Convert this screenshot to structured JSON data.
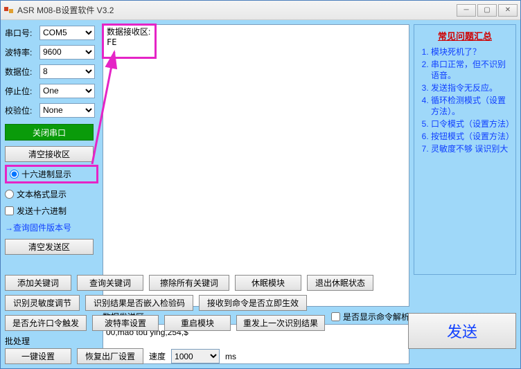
{
  "window": {
    "title": "ASR M08-B设置软件 V3.2"
  },
  "serial": {
    "port_label": "串口号:",
    "port_value": "COM5",
    "baud_label": "波特率:",
    "baud_value": "9600",
    "databits_label": "数据位:",
    "databits_value": "8",
    "stopbits_label": "停止位:",
    "stopbits_value": "One",
    "parity_label": "校验位:",
    "parity_value": "None",
    "close_btn": "关闭串口",
    "clear_recv_btn": "清空接收区",
    "radio_hex": "十六进制显示",
    "radio_text": "文本格式显示",
    "chk_send_hex": "发送十六进制",
    "link_fw": "→查询固件版本号",
    "clear_send_btn": "清空发送区"
  },
  "recv": {
    "label": "数据接收区:",
    "data": "FE"
  },
  "send": {
    "label": "数据发送区:",
    "chk_parse": "是否显示命令解析",
    "data": "00,mao tou ying,254,$"
  },
  "faq": {
    "title": "常见问题汇总",
    "items": [
      "模块死机了？",
      "串口正常，但不识别语音。",
      "发送指令无反应。",
      "循环检测模式（设置方法）。",
      "口令模式（设置方法）",
      "按钮模式（设置方法）",
      "灵敏度不够 误识别大"
    ]
  },
  "buttons": {
    "add_kw": "添加关键词",
    "query_kw": "查询关键词",
    "erase_kw": "擦除所有关键词",
    "sleep": "休眠模块",
    "exit_sleep": "退出休眠状态",
    "sens_adj": "识别灵敏度调节",
    "embed_check": "识别结果是否嵌入检验码",
    "cmd_effect": "接收到命令是否立即生效",
    "allow_pwd": "是否允许口令触发",
    "baud_set": "波特率设置",
    "restart": "重启模块",
    "resend_last": "重发上一次识别结果",
    "send": "发送"
  },
  "batch": {
    "label": "批处理",
    "one_key": "一键设置",
    "restore": "恢复出厂设置",
    "speed_label": "速度",
    "speed_value": "1000",
    "speed_unit": "ms"
  }
}
